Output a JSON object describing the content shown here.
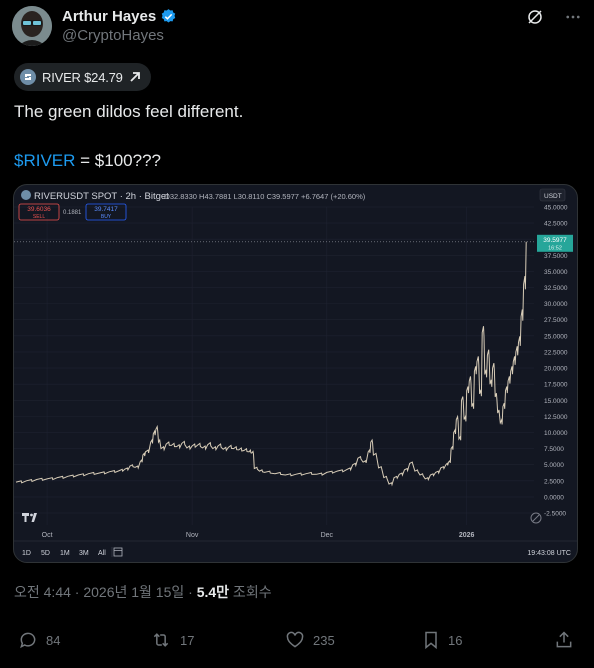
{
  "author": {
    "name": "Arthur Hayes",
    "handle": "@CryptoHayes"
  },
  "ticker_chip": {
    "label": "RIVER $24.79"
  },
  "tweet": {
    "line1": "The green dildos feel different.",
    "cashtag": "$RIVER",
    "line2_rest": " = $100???"
  },
  "chart_data": {
    "type": "line",
    "title": "RIVERUSDT SPOT · 2h · Bitget",
    "ohlc": {
      "O": "32.8330",
      "H": "43.7881",
      "L": "30.8110",
      "C": "39.5977",
      "change": "+6.7647 (+20.60%)"
    },
    "sell_box": {
      "price": "39.6036",
      "label": "SELL"
    },
    "spread": "0.1881",
    "buy_box": {
      "price": "39.7417",
      "label": "BUY"
    },
    "currency_label": "USDT",
    "last_price_tag": "39.5977",
    "last_price_sub": "16:52",
    "y_ticks": [
      "45.0000",
      "42.5000",
      "40.0000",
      "37.5000",
      "35.0000",
      "32.5000",
      "30.0000",
      "27.5000",
      "25.0000",
      "22.5000",
      "20.0000",
      "17.5000",
      "15.0000",
      "12.5000",
      "10.0000",
      "7.5000",
      "5.0000",
      "2.5000",
      "0.0000",
      "-2.5000"
    ],
    "x_ticks": [
      {
        "label": "Oct",
        "t": 0.06
      },
      {
        "label": "Nov",
        "t": 0.34
      },
      {
        "label": "Dec",
        "t": 0.6
      },
      {
        "label": "2026",
        "t": 0.87
      }
    ],
    "ylim": [
      -2.5,
      45
    ],
    "series": [
      {
        "values": [
          [
            0,
            2.3
          ],
          [
            0.02,
            2.5
          ],
          [
            0.04,
            2.7
          ],
          [
            0.06,
            2.8
          ],
          [
            0.08,
            3.0
          ],
          [
            0.1,
            3.2
          ],
          [
            0.12,
            3.4
          ],
          [
            0.14,
            3.6
          ],
          [
            0.16,
            3.7
          ],
          [
            0.18,
            3.9
          ],
          [
            0.2,
            4.1
          ],
          [
            0.21,
            4.3
          ],
          [
            0.22,
            4.8
          ],
          [
            0.23,
            4.6
          ],
          [
            0.24,
            5.5
          ],
          [
            0.245,
            6.5
          ],
          [
            0.25,
            7.0
          ],
          [
            0.26,
            8.5
          ],
          [
            0.265,
            9.8
          ],
          [
            0.27,
            10.5
          ],
          [
            0.275,
            8.5
          ],
          [
            0.28,
            7.5
          ],
          [
            0.29,
            8.2
          ],
          [
            0.3,
            8.0
          ],
          [
            0.31,
            7.8
          ],
          [
            0.32,
            8.3
          ],
          [
            0.33,
            7.6
          ],
          [
            0.34,
            7.9
          ],
          [
            0.35,
            8.0
          ],
          [
            0.36,
            7.6
          ],
          [
            0.37,
            8.1
          ],
          [
            0.38,
            7.5
          ],
          [
            0.39,
            7.9
          ],
          [
            0.4,
            7.4
          ],
          [
            0.41,
            7.7
          ],
          [
            0.42,
            7.5
          ],
          [
            0.43,
            7.3
          ],
          [
            0.44,
            7.2
          ],
          [
            0.45,
            7.0
          ],
          [
            0.455,
            6.8
          ],
          [
            0.46,
            4.4
          ],
          [
            0.47,
            4.0
          ],
          [
            0.48,
            3.8
          ],
          [
            0.5,
            3.6
          ],
          [
            0.52,
            3.4
          ],
          [
            0.54,
            3.5
          ],
          [
            0.56,
            3.6
          ],
          [
            0.58,
            3.5
          ],
          [
            0.6,
            3.8
          ],
          [
            0.62,
            4.0
          ],
          [
            0.64,
            4.3
          ],
          [
            0.65,
            5.0
          ],
          [
            0.66,
            6.0
          ],
          [
            0.67,
            5.4
          ],
          [
            0.68,
            7.0
          ],
          [
            0.685,
            8.5
          ],
          [
            0.69,
            6.5
          ],
          [
            0.7,
            4.5
          ],
          [
            0.71,
            3.0
          ],
          [
            0.72,
            2.0
          ],
          [
            0.73,
            3.0
          ],
          [
            0.74,
            3.5
          ],
          [
            0.75,
            4.2
          ],
          [
            0.76,
            5.2
          ],
          [
            0.77,
            4.0
          ],
          [
            0.78,
            3.4
          ],
          [
            0.79,
            2.8
          ],
          [
            0.8,
            3.4
          ],
          [
            0.81,
            3.8
          ],
          [
            0.82,
            4.5
          ],
          [
            0.83,
            5.0
          ],
          [
            0.835,
            5.4
          ],
          [
            0.84,
            7.5
          ],
          [
            0.845,
            10.0
          ],
          [
            0.85,
            12.0
          ],
          [
            0.855,
            9.0
          ],
          [
            0.86,
            15.0
          ],
          [
            0.865,
            12.0
          ],
          [
            0.87,
            16.5
          ],
          [
            0.875,
            18.0
          ],
          [
            0.88,
            14.0
          ],
          [
            0.885,
            19.5
          ],
          [
            0.89,
            21.0
          ],
          [
            0.895,
            16.0
          ],
          [
            0.9,
            25.5
          ],
          [
            0.905,
            19.0
          ],
          [
            0.91,
            22.0
          ],
          [
            0.915,
            17.5
          ],
          [
            0.92,
            20.0
          ],
          [
            0.925,
            15.5
          ],
          [
            0.93,
            13.0
          ],
          [
            0.935,
            11.5
          ],
          [
            0.94,
            14.0
          ],
          [
            0.945,
            16.5
          ],
          [
            0.95,
            18.0
          ],
          [
            0.955,
            19.5
          ],
          [
            0.96,
            21.0
          ],
          [
            0.965,
            22.5
          ],
          [
            0.97,
            24.0
          ],
          [
            0.975,
            28.0
          ],
          [
            0.98,
            33.0
          ],
          [
            0.985,
            39.6
          ]
        ]
      }
    ],
    "toolbar": {
      "ranges": [
        "1D",
        "5D",
        "1M",
        "3M",
        "All"
      ],
      "time": "19:43:08 UTC"
    }
  },
  "meta": {
    "time_date": "오전 4:44 · 2026년 1월 15일 · ",
    "views": "5.4만",
    "views_label": " 조회수"
  },
  "actions": {
    "replies": "84",
    "reposts": "17",
    "likes": "235",
    "bookmarks": "16"
  },
  "colors": {
    "background": "#000000",
    "chart_bg": "#131722",
    "line": "#d8cdb8",
    "accent_blue": "#1d9bf0",
    "price_tag": "#26a69a",
    "muted": "#71767b"
  }
}
